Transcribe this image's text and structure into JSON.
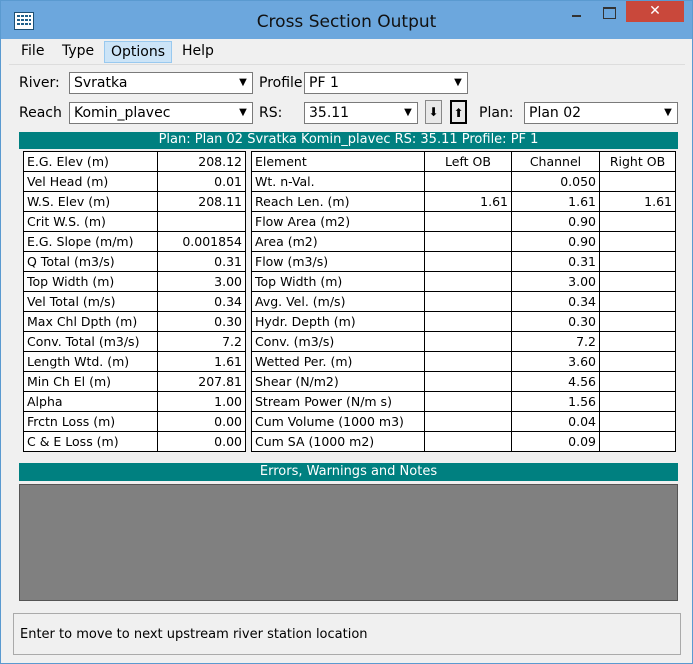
{
  "window": {
    "title": "Cross Section Output"
  },
  "menu": {
    "items": [
      "File",
      "Type",
      "Options",
      "Help"
    ],
    "active": "Options"
  },
  "selectors": {
    "river_label": "River:",
    "river": "Svratka",
    "profile_label": "Profile:",
    "profile": "PF 1",
    "reach_label": "Reach",
    "reach": "Komin_plavec",
    "rs_label": "RS:",
    "rs": "35.11",
    "plan_label": "Plan:",
    "plan": "Plan 02"
  },
  "header_band": "Plan: Plan 02    Svratka    Komin_plavec  RS: 35.11     Profile: PF 1",
  "left_table": [
    [
      "E.G. Elev (m)",
      "208.12"
    ],
    [
      "Vel Head (m)",
      "0.01"
    ],
    [
      "W.S. Elev (m)",
      "208.11"
    ],
    [
      "Crit W.S. (m)",
      ""
    ],
    [
      "E.G. Slope (m/m)",
      "0.001854"
    ],
    [
      "Q Total (m3/s)",
      "0.31"
    ],
    [
      "Top Width (m)",
      "3.00"
    ],
    [
      "Vel Total (m/s)",
      "0.34"
    ],
    [
      "Max Chl Dpth (m)",
      "0.30"
    ],
    [
      "Conv. Total (m3/s)",
      "7.2"
    ],
    [
      "Length Wtd. (m)",
      "1.61"
    ],
    [
      "Min Ch El (m)",
      "207.81"
    ],
    [
      "Alpha",
      "1.00"
    ],
    [
      "Frctn Loss (m)",
      "0.00"
    ],
    [
      "C & E Loss (m)",
      "0.00"
    ]
  ],
  "right_table": {
    "headers": [
      "Element",
      "Left OB",
      "Channel",
      "Right OB"
    ],
    "rows": [
      [
        "Wt. n-Val.",
        "",
        "0.050",
        ""
      ],
      [
        "Reach Len. (m)",
        "1.61",
        "1.61",
        "1.61"
      ],
      [
        "Flow Area (m2)",
        "",
        "0.90",
        ""
      ],
      [
        "Area (m2)",
        "",
        "0.90",
        ""
      ],
      [
        "Flow (m3/s)",
        "",
        "0.31",
        ""
      ],
      [
        "Top Width (m)",
        "",
        "3.00",
        ""
      ],
      [
        "Avg. Vel. (m/s)",
        "",
        "0.34",
        ""
      ],
      [
        "Hydr. Depth (m)",
        "",
        "0.30",
        ""
      ],
      [
        "Conv. (m3/s)",
        "",
        "7.2",
        ""
      ],
      [
        "Wetted Per. (m)",
        "",
        "3.60",
        ""
      ],
      [
        "Shear (N/m2)",
        "",
        "4.56",
        ""
      ],
      [
        "Stream Power (N/m s)",
        "",
        "1.56",
        ""
      ],
      [
        "Cum Volume (1000 m3)",
        "",
        "0.04",
        ""
      ],
      [
        "Cum SA (1000 m2)",
        "",
        "0.09",
        ""
      ]
    ]
  },
  "errors_band": "Errors, Warnings and Notes",
  "status_text": "Enter to move to next upstream river station location",
  "colors": {
    "band": "#008080",
    "titlebar": "#6ca7dd",
    "close": "#c9483b",
    "notes_bg": "#808080"
  }
}
